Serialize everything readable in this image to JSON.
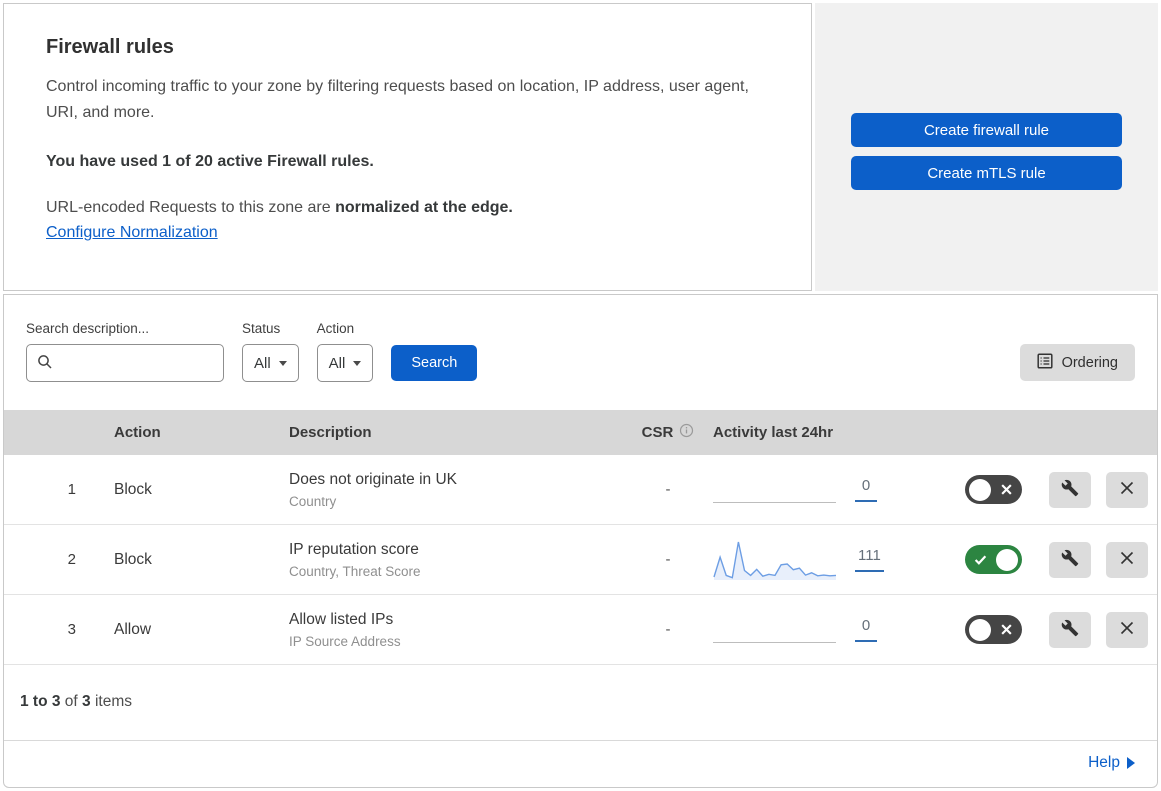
{
  "header": {
    "title": "Firewall rules",
    "description": "Control incoming traffic to your zone by filtering requests based on location, IP address, user agent, URI, and more.",
    "usage_notice": "You have used 1 of 20 active Firewall rules.",
    "normalization_prefix": "URL-encoded Requests to this zone are ",
    "normalization_bold": "normalized at the edge.",
    "normalization_link": "Configure Normalization"
  },
  "actions_panel": {
    "create_firewall_rule_label": "Create firewall rule",
    "create_mtls_rule_label": "Create mTLS rule"
  },
  "filter_bar": {
    "search_label": "Search description...",
    "search_value": "",
    "status_label": "Status",
    "status_value": "All",
    "action_label": "Action",
    "action_value": "All",
    "search_button_label": "Search",
    "ordering_button_label": "Ordering"
  },
  "table": {
    "columns": {
      "action": "Action",
      "description": "Description",
      "csr": "CSR",
      "activity": "Activity last 24hr"
    },
    "rows": [
      {
        "num": "1",
        "action": "Block",
        "description": "Does not originate in UK",
        "fields": "Country",
        "csr": "-",
        "activity_count": "0",
        "enabled": false,
        "sparkline": []
      },
      {
        "num": "2",
        "action": "Block",
        "description": "IP reputation score",
        "fields": "Country, Threat Score",
        "csr": "-",
        "activity_count": "111",
        "enabled": true,
        "sparkline": [
          8,
          60,
          12,
          6,
          100,
          25,
          12,
          28,
          10,
          15,
          12,
          40,
          42,
          27,
          31,
          13,
          19,
          11,
          13,
          11,
          12
        ]
      },
      {
        "num": "3",
        "action": "Allow",
        "description": "Allow listed IPs",
        "fields": "IP Source Address",
        "csr": "-",
        "activity_count": "0",
        "enabled": false,
        "sparkline": []
      }
    ]
  },
  "footer": {
    "range": "1 to 3",
    "of_text": "of",
    "total": "3",
    "items_text": "items",
    "help_label": "Help"
  },
  "colors": {
    "accent_blue": "#0c5fc9",
    "toggle_on_green": "#2c8541",
    "toggle_off_gray": "#454545",
    "sparkline_blue": "#6d9ee4",
    "table_header_gray": "#d7d7d7",
    "panel_gray": "#f1f1f1"
  }
}
